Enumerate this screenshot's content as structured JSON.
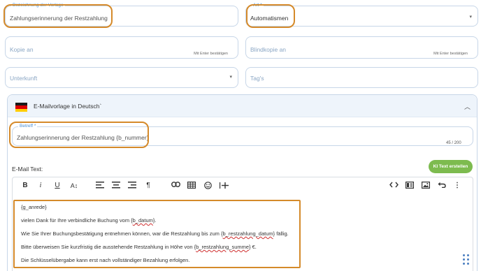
{
  "template_name": {
    "label": "Bezeichnung der Vorlage",
    "value": "Zahlungserinnerung der Restzahlung"
  },
  "type": {
    "label": "Art *",
    "value": "Automatismen"
  },
  "copy": {
    "placeholder": "Kopie an",
    "hint": "Mit Enter bestätigen"
  },
  "bcc": {
    "placeholder": "Blindkopie an",
    "hint": "Mit Enter bestätigen"
  },
  "accommodation": {
    "placeholder": "Unterkunft"
  },
  "tags": {
    "placeholder": "Tag's"
  },
  "email_panel": {
    "title": "E-Mailvorlage in Deutsch`",
    "flag": "german-flag",
    "subject": {
      "label": "Betreff *",
      "value": "Zahlungserinnerung der Restzahlung {b_nummer}",
      "counter": "45 / 200"
    },
    "text_label": "E-Mail Text:",
    "ai_button": "KI Text erstellen"
  },
  "toolbar": {
    "bold": "B",
    "italic": "i",
    "underline": "U",
    "font_size": "A↕",
    "paragraph": "¶",
    "more": "⋮",
    "icons": [
      "bold-icon",
      "italic-icon",
      "underline-icon",
      "font-size-icon",
      "align-left-icon",
      "align-center-icon",
      "align-right-icon",
      "paragraph-icon",
      "link-icon",
      "table-icon",
      "emoji-icon",
      "insert-variable-icon",
      "code-view-icon",
      "template-icon",
      "image-icon",
      "undo-icon",
      "more-icon"
    ]
  },
  "body_lines": {
    "line1": "{g_anrede}",
    "line2_a": "vielen Dank für Ihre verbindliche Buchung vom {",
    "line2_b": "b_datum",
    "line2_c": "}.",
    "line3_a": "Wie Sie Ihrer Buchungsbestätigung entnehmen können, war die Restzahlung bis zum {",
    "line3_b": "b_restzahlung_datum",
    "line3_c": "} fällig.",
    "line4_a": "Bitte überweisen Sie kurzfristig die ausstehende Restzahlung in Höhe von {",
    "line4_b": "b_restzahlung_summe",
    "line4_c": "} €.",
    "line5": "Die Schlüsselübergabe kann erst nach vollständiger Bezahlung erfolgen."
  },
  "colors": {
    "accent": "#4a8fd6",
    "highlight": "#d58a2a",
    "ai_button": "#7dbb4f",
    "panel_header": "#eef4fb"
  }
}
